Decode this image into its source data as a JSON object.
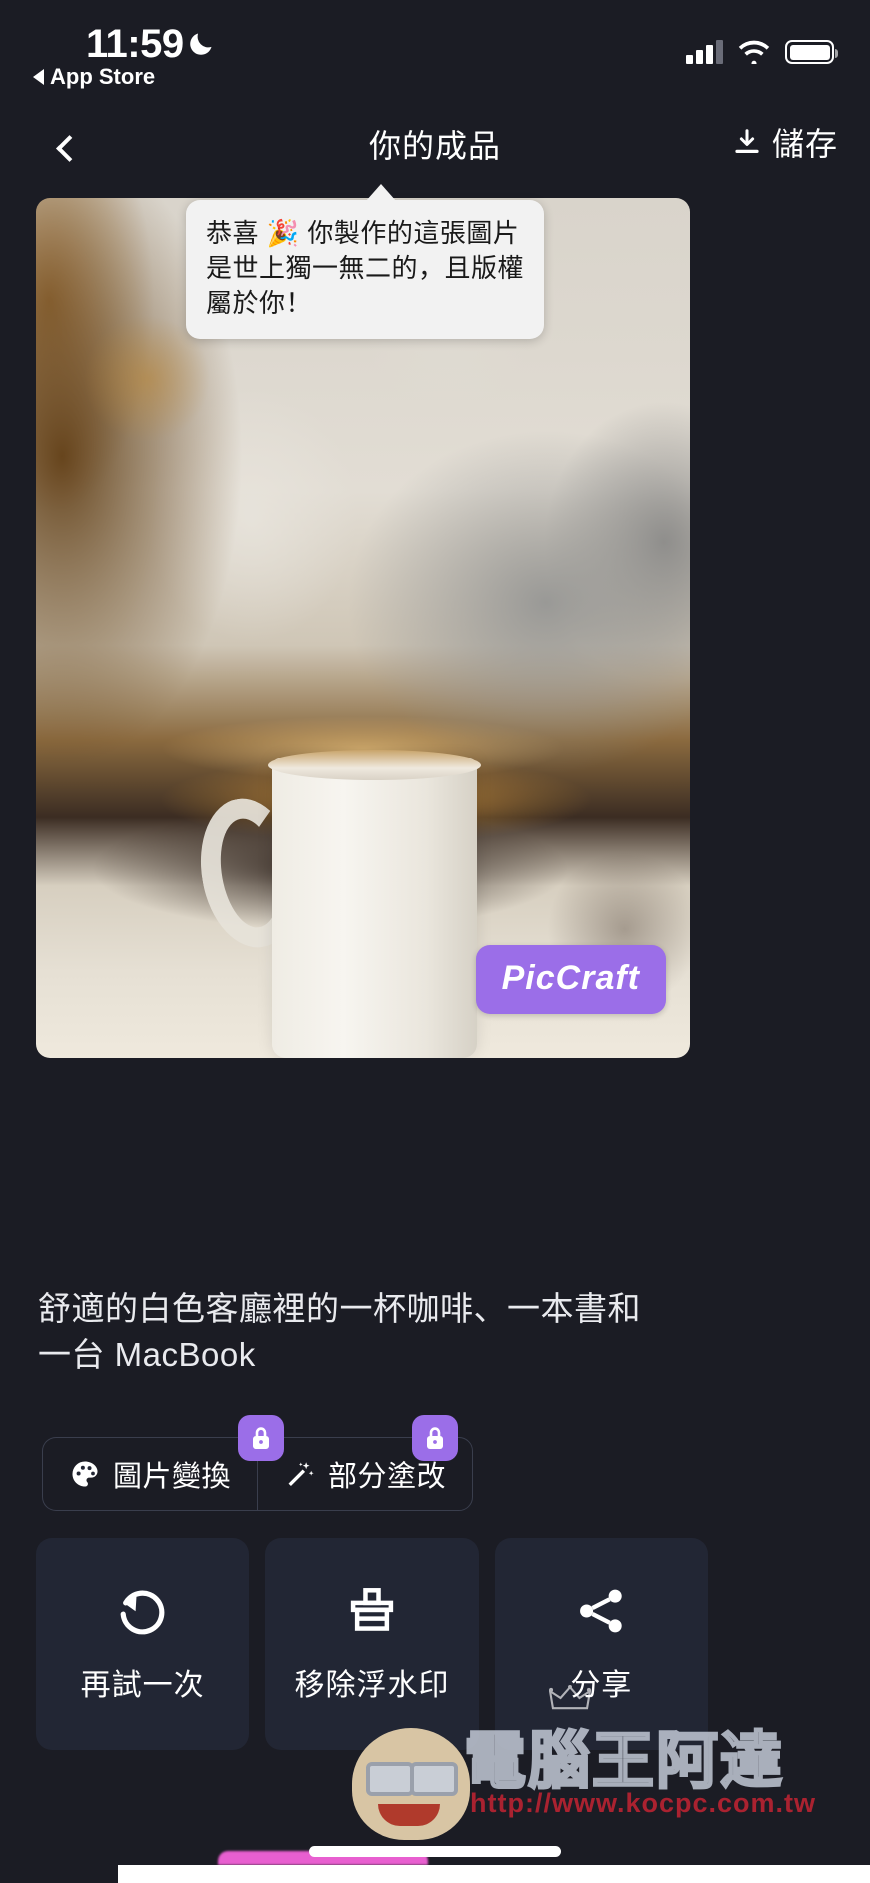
{
  "status_bar": {
    "time": "11:59",
    "moon_icon": "crescent-moon-icon",
    "back_app_label": "App Store",
    "signal_icon": "cellular-signal-icon",
    "wifi_icon": "wifi-icon",
    "battery_icon": "battery-full-icon"
  },
  "nav": {
    "back_icon": "chevron-left-icon",
    "title": "你的成品",
    "save_label": "儲存",
    "save_icon": "download-icon"
  },
  "bubble": {
    "text": "恭喜 🎉 你製作的這張圖片是世上獨一無二的，且版權屬於你！"
  },
  "photo": {
    "alt_name": "generated-coffee-macbook-photo",
    "watermark_text": "PicCraft",
    "watermark_color": "#9b6ee8"
  },
  "caption": {
    "text": "舒適的白色客廳裡的一杯咖啡、一本書和一台 MacBook"
  },
  "segmented": {
    "lock_icon": "lock-icon",
    "items": [
      {
        "label": "圖片變換",
        "icon": "palette-icon",
        "locked": true
      },
      {
        "label": "部分塗改",
        "icon": "magic-wand-icon",
        "locked": true
      }
    ]
  },
  "action_cards": [
    {
      "label": "再試一次",
      "icon": "rotate-ccw-icon",
      "premium": false
    },
    {
      "label": "移除浮水印",
      "icon": "stamp-icon",
      "premium": false
    },
    {
      "label": "分享",
      "icon": "share-icon",
      "premium": true,
      "badge_icon": "crown-icon"
    }
  ],
  "site_watermark": {
    "name": "電腦王阿達",
    "url": "http://www.kocpc.com.tw",
    "mascot_icon": "mascot-face-icon"
  },
  "theme": {
    "background": "#1b1c24",
    "card_background": "#222634",
    "accent": "#9b6ee8",
    "text_primary": "#ffffff",
    "border": "#3a3e4d"
  }
}
